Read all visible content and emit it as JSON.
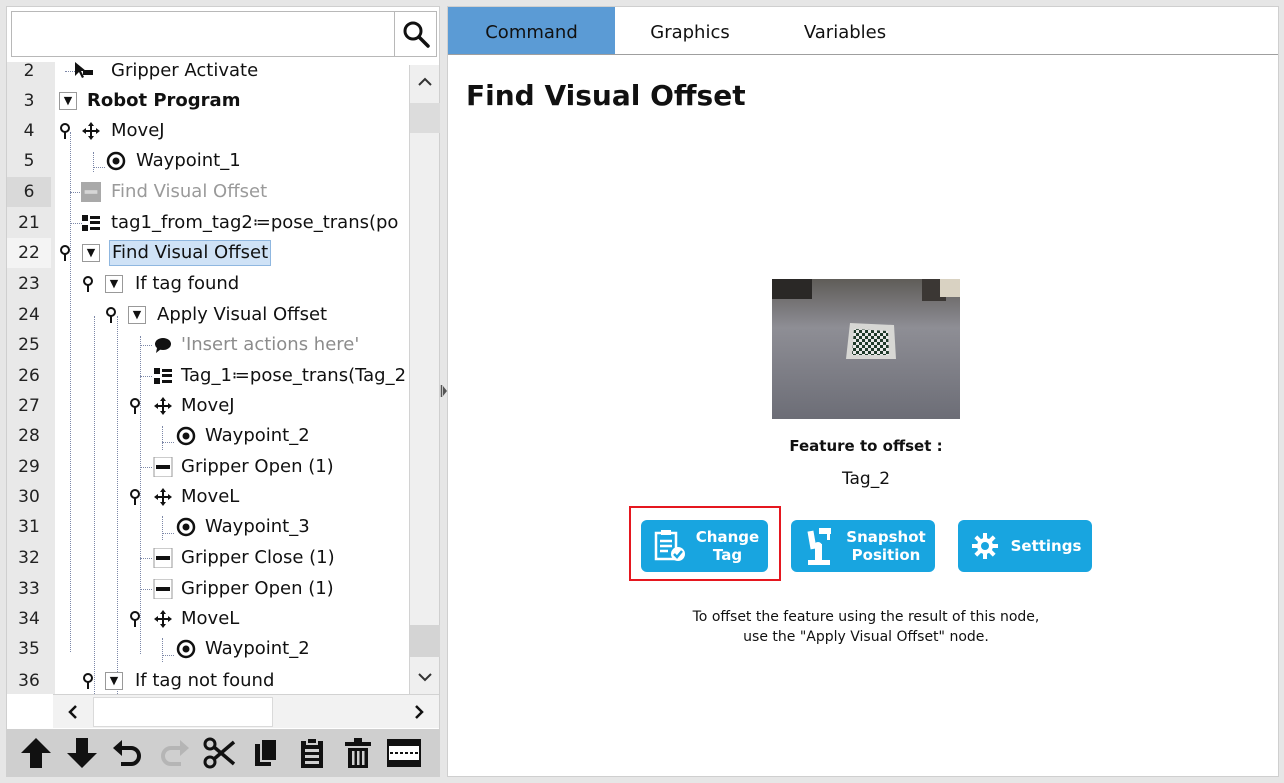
{
  "search": {
    "placeholder": "",
    "value": ""
  },
  "tree": {
    "rows": [
      {
        "line": "2",
        "label": "Gripper Activate"
      },
      {
        "line": "3",
        "label": "Robot Program"
      },
      {
        "line": "4",
        "label": "MoveJ"
      },
      {
        "line": "5",
        "label": "Waypoint_1"
      },
      {
        "line": "6",
        "label": "Find Visual Offset"
      },
      {
        "line": "21",
        "label": "tag1_from_tag2≔pose_trans(po"
      },
      {
        "line": "22",
        "label": "Find Visual Offset"
      },
      {
        "line": "23",
        "label": "If tag found"
      },
      {
        "line": "24",
        "label": "Apply Visual Offset"
      },
      {
        "line": "25",
        "label": "'Insert actions here'"
      },
      {
        "line": "26",
        "label": "Tag_1≔pose_trans(Tag_2"
      },
      {
        "line": "27",
        "label": "MoveJ"
      },
      {
        "line": "28",
        "label": "Waypoint_2"
      },
      {
        "line": "29",
        "label": "Gripper Open (1)"
      },
      {
        "line": "30",
        "label": "MoveL"
      },
      {
        "line": "31",
        "label": "Waypoint_3"
      },
      {
        "line": "32",
        "label": "Gripper Close (1)"
      },
      {
        "line": "33",
        "label": "Gripper Open (1)"
      },
      {
        "line": "34",
        "label": "MoveL"
      },
      {
        "line": "35",
        "label": "Waypoint_2"
      },
      {
        "line": "36",
        "label": "If tag not found"
      }
    ]
  },
  "toolbar": {
    "buttons": [
      "move-up",
      "move-down",
      "undo",
      "redo",
      "cut",
      "copy",
      "paste",
      "delete",
      "suppress"
    ]
  },
  "tabs": [
    {
      "label": "Command",
      "active": true
    },
    {
      "label": "Graphics",
      "active": false
    },
    {
      "label": "Variables",
      "active": false
    }
  ],
  "command": {
    "title": "Find Visual Offset",
    "feature_label": "Feature to offset :",
    "feature_value": "Tag_2",
    "buttons": {
      "change_tag": "Change\nTag",
      "snapshot_position": "Snapshot\nPosition",
      "settings": "Settings"
    },
    "help_text": "To offset the feature using the result of this node,\nuse the \"Apply Visual Offset\" node."
  },
  "colors": {
    "accent_tab": "#5b9bd5",
    "button_blue": "#18a5e0",
    "highlight_red": "#e5171f",
    "selection_bg": "#cfe2f6"
  }
}
